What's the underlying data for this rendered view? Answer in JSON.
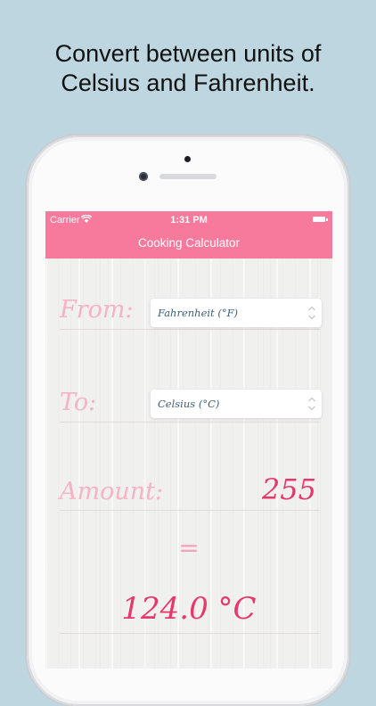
{
  "headline": {
    "line1": "Convert between units of",
    "line2": "Celsius and Fahrenheit."
  },
  "status_bar": {
    "carrier": "Carrier",
    "time": "1:31 PM"
  },
  "nav": {
    "title": "Cooking Calculator"
  },
  "form": {
    "from_label": "From:",
    "from_value": "Fahrenheit (°F)",
    "to_label": "To:",
    "to_value": "Celsius (°C)",
    "amount_label": "Amount:",
    "amount_value": "255",
    "equals": "=",
    "result": "124.0 °C"
  },
  "colors": {
    "nav_bar": "#f7799c",
    "accent": "#e8386b",
    "label": "#f5b3c4",
    "background": "#bdd6e0"
  },
  "icons": [
    "wifi-icon",
    "battery-icon",
    "chevron-updown-icon"
  ]
}
